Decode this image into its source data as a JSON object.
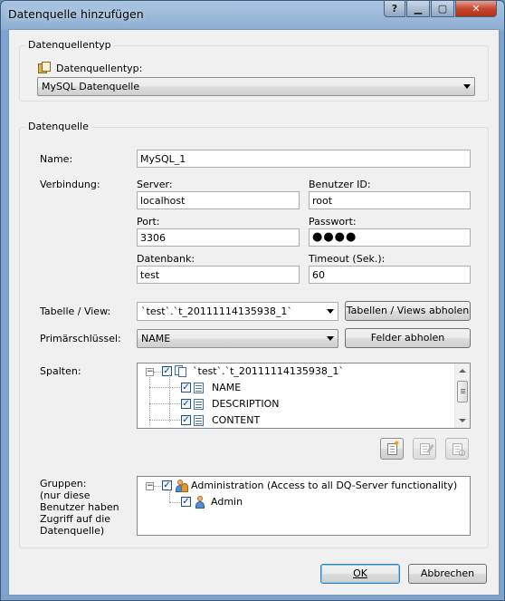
{
  "window": {
    "title": "Datenquelle hinzufügen",
    "help_btn": "?",
    "min_btn": "▁",
    "max_btn": "▢",
    "close_btn": "✕"
  },
  "source_type_group": {
    "legend": "Datenquellentyp",
    "label": "Datenquellentyp:",
    "selected": "MySQL Datenquelle"
  },
  "datasource_group": {
    "legend": "Datenquelle",
    "name_label": "Name:",
    "name_value": "MySQL_1",
    "connection_label": "Verbindung:",
    "server_label": "Server:",
    "server_value": "localhost",
    "user_label": "Benutzer ID:",
    "user_value": "root",
    "port_label": "Port:",
    "port_value": "3306",
    "password_label": "Passwort:",
    "password_value": "●●●●",
    "database_label": "Datenbank:",
    "database_value": "test",
    "timeout_label": "Timeout (Sek.):",
    "timeout_value": "60",
    "table_label": "Tabelle / View:",
    "table_value": "`test`.`t_20111114135938_1`",
    "fetch_tables_btn": "Tabellen / Views abholen",
    "primary_key_label": "Primärschlüssel:",
    "primary_key_value": "NAME",
    "fetch_fields_btn": "Felder abholen",
    "columns_label": "Spalten:",
    "columns_tree": {
      "root": "`test`.`t_20111114135938_1`",
      "items": [
        "NAME",
        "DESCRIPTION",
        "CONTENT"
      ]
    },
    "groups_label": "Gruppen:\n(nur diese\nBenutzer haben\nZugriff auf die\nDatenquelle)",
    "groups_tree": {
      "root": "Administration (Access to all DQ-Server functionality)",
      "items": [
        "Admin"
      ]
    }
  },
  "footer": {
    "ok_btn": "OK",
    "cancel_btn": "Abbrechen"
  }
}
